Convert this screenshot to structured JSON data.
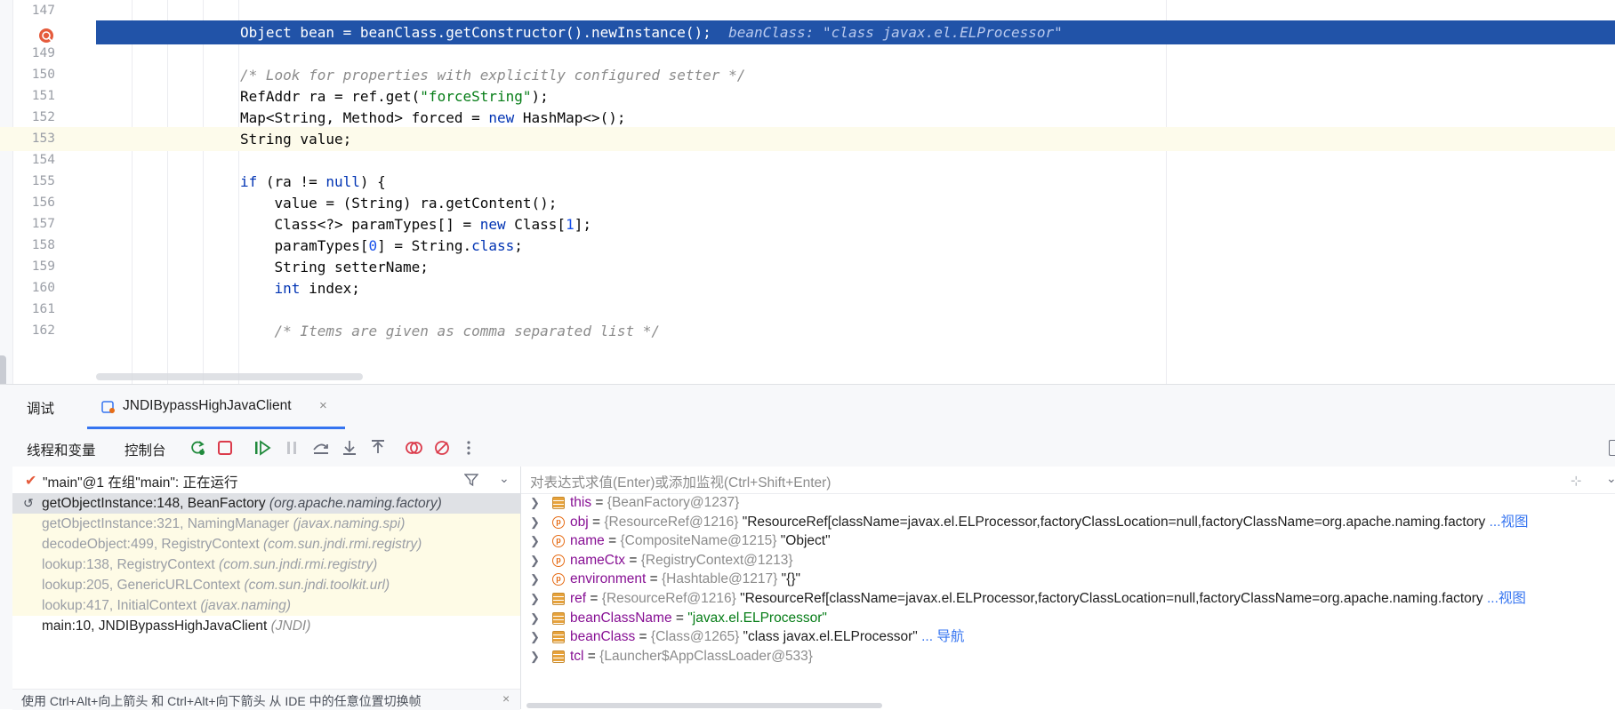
{
  "editor": {
    "lines": [
      {
        "num": "147",
        "tokens": [
          {
            "t": "",
            "c": ""
          }
        ]
      },
      {
        "num": "148",
        "tokens": [
          {
            "t": "Object bean = beanClass.getConstructor().newInstance();",
            "c": ""
          }
        ],
        "inline_value": "beanClass: \"class javax.el.ELProcessor\""
      },
      {
        "num": "149",
        "tokens": [
          {
            "t": "",
            "c": ""
          }
        ]
      },
      {
        "num": "150",
        "tokens": [
          {
            "t": "/* Look for properties with explicitly configured setter */",
            "c": "cmt"
          }
        ]
      },
      {
        "num": "151",
        "tokens": [
          {
            "t": "RefAddr ra = ref.get(",
            "c": ""
          },
          {
            "t": "\"forceString\"",
            "c": "str"
          },
          {
            "t": ");",
            "c": ""
          }
        ]
      },
      {
        "num": "152",
        "tokens": [
          {
            "t": "Map<String, Method> forced = ",
            "c": ""
          },
          {
            "t": "new",
            "c": "kw"
          },
          {
            "t": " HashMap<>();",
            "c": ""
          }
        ]
      },
      {
        "num": "153",
        "tokens": [
          {
            "t": "String value;",
            "c": ""
          }
        ]
      },
      {
        "num": "154",
        "tokens": [
          {
            "t": "",
            "c": ""
          }
        ]
      },
      {
        "num": "155",
        "tokens": [
          {
            "t": "if",
            "c": "kw"
          },
          {
            "t": " (ra != ",
            "c": ""
          },
          {
            "t": "null",
            "c": "kw"
          },
          {
            "t": ") {",
            "c": ""
          }
        ]
      },
      {
        "num": "156",
        "tokens": [
          {
            "t": "    value = (String) ra.getContent();",
            "c": ""
          }
        ]
      },
      {
        "num": "157",
        "tokens": [
          {
            "t": "    Class<?> paramTypes[] = ",
            "c": ""
          },
          {
            "t": "new",
            "c": "kw"
          },
          {
            "t": " Class[",
            "c": ""
          },
          {
            "t": "1",
            "c": "num"
          },
          {
            "t": "];",
            "c": ""
          }
        ]
      },
      {
        "num": "158",
        "tokens": [
          {
            "t": "    paramTypes[",
            "c": ""
          },
          {
            "t": "0",
            "c": "num"
          },
          {
            "t": "] = String.",
            "c": ""
          },
          {
            "t": "class",
            "c": "kw"
          },
          {
            "t": ";",
            "c": ""
          }
        ]
      },
      {
        "num": "159",
        "tokens": [
          {
            "t": "    String setterName;",
            "c": ""
          }
        ]
      },
      {
        "num": "160",
        "tokens": [
          {
            "t": "    ",
            "c": ""
          },
          {
            "t": "int",
            "c": "kw"
          },
          {
            "t": " index;",
            "c": ""
          }
        ]
      },
      {
        "num": "161",
        "tokens": [
          {
            "t": "",
            "c": ""
          }
        ]
      },
      {
        "num": "162",
        "tokens": [
          {
            "t": "    /* Items are given as comma separated list */",
            "c": "cmt"
          }
        ]
      }
    ]
  },
  "debug": {
    "tab_label": "调试",
    "session_label": "JNDIBypassHighJavaClient",
    "session_close": "×",
    "threads_tab": "线程和变量",
    "console_tab": "控制台",
    "thread_status": "\"main\"@1 在组\"main\": 正在运行",
    "frames": [
      {
        "method": "getObjectInstance:148, BeanFactory",
        "pkg": "(org.apache.naming.factory)",
        "style": "selected"
      },
      {
        "method": "getObjectInstance:321, NamingManager",
        "pkg": "(javax.naming.spi)",
        "style": "lib"
      },
      {
        "method": "decodeObject:499, RegistryContext",
        "pkg": "(com.sun.jndi.rmi.registry)",
        "style": "lib"
      },
      {
        "method": "lookup:138, RegistryContext",
        "pkg": "(com.sun.jndi.rmi.registry)",
        "style": "lib"
      },
      {
        "method": "lookup:205, GenericURLContext",
        "pkg": "(com.sun.jndi.toolkit.url)",
        "style": "lib"
      },
      {
        "method": "lookup:417, InitialContext",
        "pkg": "(javax.naming)",
        "style": "lib"
      },
      {
        "method": "main:10, JNDIBypassHighJavaClient",
        "pkg": "(JNDI)",
        "style": "normal"
      }
    ],
    "hint": "使用 Ctrl+Alt+向上箭头 和 Ctrl+Alt+向下箭头 从 IDE 中的任意位置切换帧",
    "hint_close": "×",
    "eval_placeholder": "对表达式求值(Enter)或添加监视(Ctrl+Shift+Enter)",
    "variables": [
      {
        "kind": "local",
        "name": "this",
        "ref": "{BeanFactory@1237}",
        "value": "",
        "link": ""
      },
      {
        "kind": "field",
        "name": "obj",
        "ref": "{ResourceRef@1216}",
        "value": "\"ResourceRef[className=javax.el.ELProcessor,factoryClassLocation=null,factoryClassName=org.apache.naming.factory",
        "link": "...视图"
      },
      {
        "kind": "field",
        "name": "name",
        "ref": "{CompositeName@1215}",
        "value": "\"Object\"",
        "link": ""
      },
      {
        "kind": "field",
        "name": "nameCtx",
        "ref": "{RegistryContext@1213}",
        "value": "",
        "link": ""
      },
      {
        "kind": "field",
        "name": "environment",
        "ref": "{Hashtable@1217}",
        "value": "\"{}\"",
        "link": ""
      },
      {
        "kind": "local",
        "name": "ref",
        "ref": "{ResourceRef@1216}",
        "value": "\"ResourceRef[className=javax.el.ELProcessor,factoryClassLocation=null,factoryClassName=org.apache.naming.factory",
        "link": "...视图"
      },
      {
        "kind": "local",
        "name": "beanClassName",
        "ref": "",
        "value": "\"javax.el.ELProcessor\"",
        "link": ""
      },
      {
        "kind": "local",
        "name": "beanClass",
        "ref": "{Class@1265}",
        "value": "\"class javax.el.ELProcessor\"",
        "link": "... 导航"
      },
      {
        "kind": "local",
        "name": "tcl",
        "ref": "{Launcher$AppClassLoader@533}",
        "value": "",
        "link": ""
      }
    ]
  },
  "colors": {
    "accent": "#3574f0",
    "exec_line": "#2153a8",
    "breakpoint": "#e55b3c"
  }
}
